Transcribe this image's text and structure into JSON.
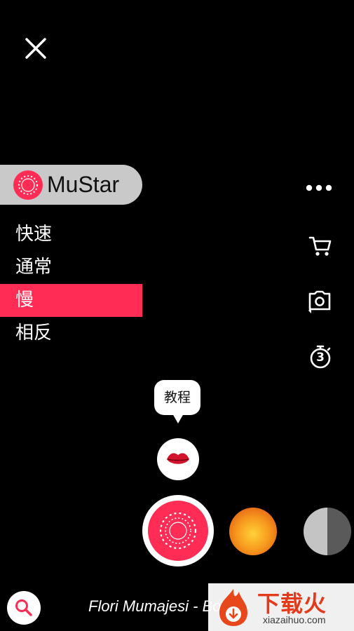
{
  "app": {
    "name": "MuStar"
  },
  "speed_options": [
    {
      "label": "快速",
      "active": false
    },
    {
      "label": "通常",
      "active": false
    },
    {
      "label": "慢",
      "active": true
    },
    {
      "label": "相反",
      "active": false
    }
  ],
  "tutorial": {
    "label": "教程"
  },
  "timer": {
    "value": "3"
  },
  "song": {
    "title": "Flori Mumajesi - Bo"
  },
  "watermark": {
    "brand": "下载火",
    "url": "xiazaihuo.com"
  },
  "colors": {
    "accent": "#ff2d55",
    "background": "#000000",
    "badge": "#c9c9c9"
  },
  "icons": {
    "close": "close-icon",
    "more": "more-dots-icon",
    "cart": "cart-icon",
    "flip_camera": "flip-camera-icon",
    "timer": "timer-icon",
    "lips": "lips-icon",
    "search": "search-icon"
  }
}
